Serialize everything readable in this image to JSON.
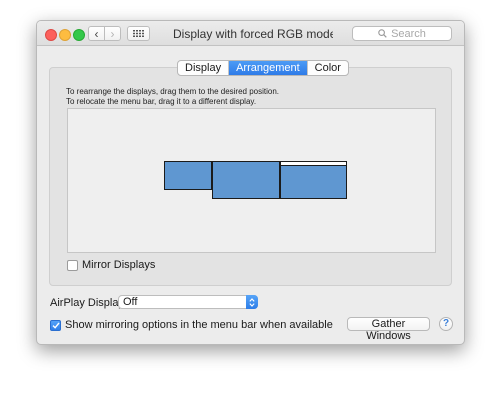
{
  "window": {
    "title": "Display with forced RGB mode (EDID",
    "search_placeholder": "Search"
  },
  "tabs": [
    {
      "label": "Display",
      "selected": false
    },
    {
      "label": "Arrangement",
      "selected": true
    },
    {
      "label": "Color",
      "selected": false
    }
  ],
  "arrangement": {
    "instruction_1": "To rearrange the displays, drag them to the desired position.",
    "instruction_2": "To relocate the menu bar, drag it to a different display.",
    "display_color": "#5f97d1"
  },
  "mirror_displays": {
    "label": "Mirror Displays",
    "checked": false
  },
  "airplay": {
    "label": "AirPlay Display:",
    "value": "Off"
  },
  "show_mirroring": {
    "label": "Show mirroring options in the menu bar when available",
    "checked": true
  },
  "gather_windows_label": "Gather Windows",
  "help_label": "?",
  "icons": {
    "back": "chevron-left-icon",
    "forward": "chevron-right-icon",
    "show_all": "grid-icon",
    "search": "magnifier-icon"
  }
}
